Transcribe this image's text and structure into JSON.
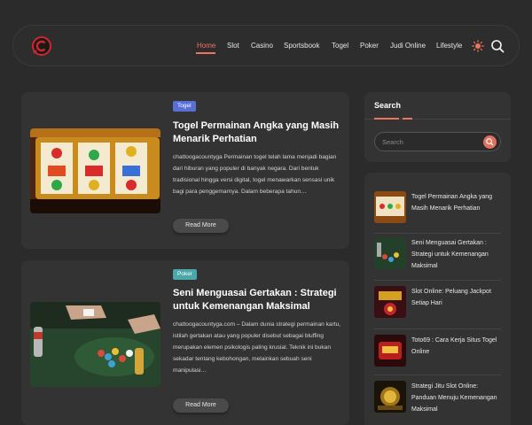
{
  "nav": {
    "items": [
      "Home",
      "Slot",
      "Casino",
      "Sportsbook",
      "Togel",
      "Poker",
      "Judi Online",
      "Lifestyle"
    ]
  },
  "icons": {
    "logo": "copyright-c-logo-icon",
    "theme": "sun-icon",
    "search": "search-icon"
  },
  "colors": {
    "accent": "#f0735e",
    "background": "#2b2b2b",
    "card": "#333333",
    "badge_togel": "#5a6fd6",
    "badge_poker": "#4aa8a8"
  },
  "posts": [
    {
      "category": "Togel",
      "title": "Togel Permainan Angka yang Masih Menarik Perhatian",
      "excerpt": "chattoogacountyga Permainan togel telah lama menjadi bagian dari hiburan yang populer di banyak negara. Dari bentuk tradisional hingga versi digital, togel menawarkan sensasi unik bagi para penggemarnya. Dalam beberapa tahun…",
      "read_more": "Read More"
    },
    {
      "category": "Poker",
      "title": "Seni Menguasai Gertakan : Strategi untuk Kemenangan Maksimal",
      "excerpt": "chattoogacountyga.com – Dalam dunia strategi permainan kartu, istilah gertakan atau yang populer disebut sebagai bluffing merupakan elemen psikologis paling krusial. Teknik ini bukan sekadar tentang kebohongan, melainkan sebuah seni manipulasi…",
      "read_more": "Read More"
    }
  ],
  "sidebar": {
    "search_title": "Search",
    "search_placeholder": "Search",
    "recent": [
      "Togel Permainan Angka yang Masih Menarik Perhatian",
      "Seni Menguasai Gertakan : Strategi untuk Kemenangan Maksimal",
      "Slot Online: Peluang Jackpot Setiap Hari",
      "Toto69 : Cara Kerja Situs Togel Online",
      "Strategi Jitu Slot Online: Panduan Menuju Kemenangan Maksimal"
    ]
  }
}
